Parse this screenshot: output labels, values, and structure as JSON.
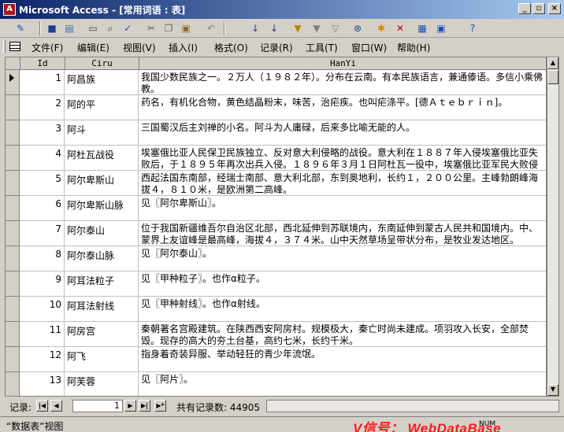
{
  "window": {
    "title": "Microsoft Access - [常用词语 : 表]",
    "buttons": {
      "minimize": "_",
      "restore": "▫",
      "close": "×"
    }
  },
  "toolbar": {
    "icons": [
      "design-view-icon",
      "save-icon",
      "file-search-icon",
      "print-icon",
      "print-preview-icon",
      "spelling-icon",
      "cut-icon",
      "copy-icon",
      "paste-icon",
      "undo-icon",
      "sort-ascending-icon",
      "sort-descending-icon",
      "filter-by-selection-icon",
      "filter-by-form-icon",
      "apply-filter-icon",
      "find-icon",
      "new-record-icon",
      "delete-record-icon",
      "database-window-icon",
      "new-object-icon",
      "help-icon"
    ]
  },
  "menu": {
    "items": [
      "文件(F)",
      "编辑(E)",
      "视图(V)",
      "插入(I)",
      "格式(O)",
      "记录(R)",
      "工具(T)",
      "窗口(W)",
      "帮助(H)"
    ]
  },
  "table": {
    "columns": [
      "Id",
      "Ciru",
      "HanYi"
    ],
    "rows": [
      {
        "id": "1",
        "ciru": "阿昌族",
        "hanyi": "我国少数民族之一。２万人（１９８２年）。分布在云南。有本民族语言，兼通傣语。多信小乘佛教。"
      },
      {
        "id": "2",
        "ciru": "阿的平",
        "hanyi": "药名，有机化合物，黄色结晶粉末，味苦，治疟疾。也叫疟涤平。[德Ａｔｅｂｒｉｎ]。"
      },
      {
        "id": "3",
        "ciru": "阿斗",
        "hanyi": "三国蜀汉后主刘禅的小名。阿斗为人庸碌，后来多比喻无能的人。"
      },
      {
        "id": "4",
        "ciru": "阿杜瓦战役",
        "hanyi": "埃塞俄比亚人民保卫民族独立、反对意大利侵略的战役。意大利在１８８７年入侵埃塞俄比亚失败后，于１８９５年再次出兵入侵。１８９６年３月１日阿杜瓦一役中，埃塞俄比亚军民大败侵"
      },
      {
        "id": "5",
        "ciru": "阿尔卑斯山",
        "hanyi": "西起法国东南部，经瑞士南部、意大利北部，东到奥地利，长约１，２００公里。主峰勃朗峰海拔４，８１０米，是欧洲第二高峰。"
      },
      {
        "id": "6",
        "ciru": "阿尔卑斯山脉",
        "hanyi": "见〖阿尔卑斯山〗。"
      },
      {
        "id": "7",
        "ciru": "阿尔泰山",
        "hanyi": "位于我国新疆维吾尔自治区北部，西北延伸到苏联境内，东南延伸到蒙古人民共和国境内。中、蒙界上友谊峰是最高峰，海拔４，３７４米。山中天然草场呈带状分布，是牧业发达地区。"
      },
      {
        "id": "8",
        "ciru": "阿尔泰山脉",
        "hanyi": "见〖阿尔泰山〗。"
      },
      {
        "id": "9",
        "ciru": "阿耳法粒子",
        "hanyi": "见〖甲种粒子〗。也作α粒子。"
      },
      {
        "id": "10",
        "ciru": "阿耳法射线",
        "hanyi": "见〖甲种射线〗。也作α射线。"
      },
      {
        "id": "11",
        "ciru": "阿房宫",
        "hanyi": "秦朝著名宫殿建筑。在陕西西安阿房村。规模极大，秦亡时尚未建成。项羽攻入长安，全部焚毁。现存的高大的夯土台基，高约七米，长约千米。"
      },
      {
        "id": "12",
        "ciru": "阿飞",
        "hanyi": "指身着奇装异服、举动轻狂的青少年流氓。"
      },
      {
        "id": "13",
        "ciru": "阿芙蓉",
        "hanyi": "见〖阿片〗。"
      }
    ]
  },
  "navigator": {
    "label": "记录:",
    "current": "1",
    "total_text": "共有记录数: 44905"
  },
  "status": {
    "text": "“数据表”视图",
    "num": "NUM",
    "watermark": "V信号： WebDataBase"
  }
}
